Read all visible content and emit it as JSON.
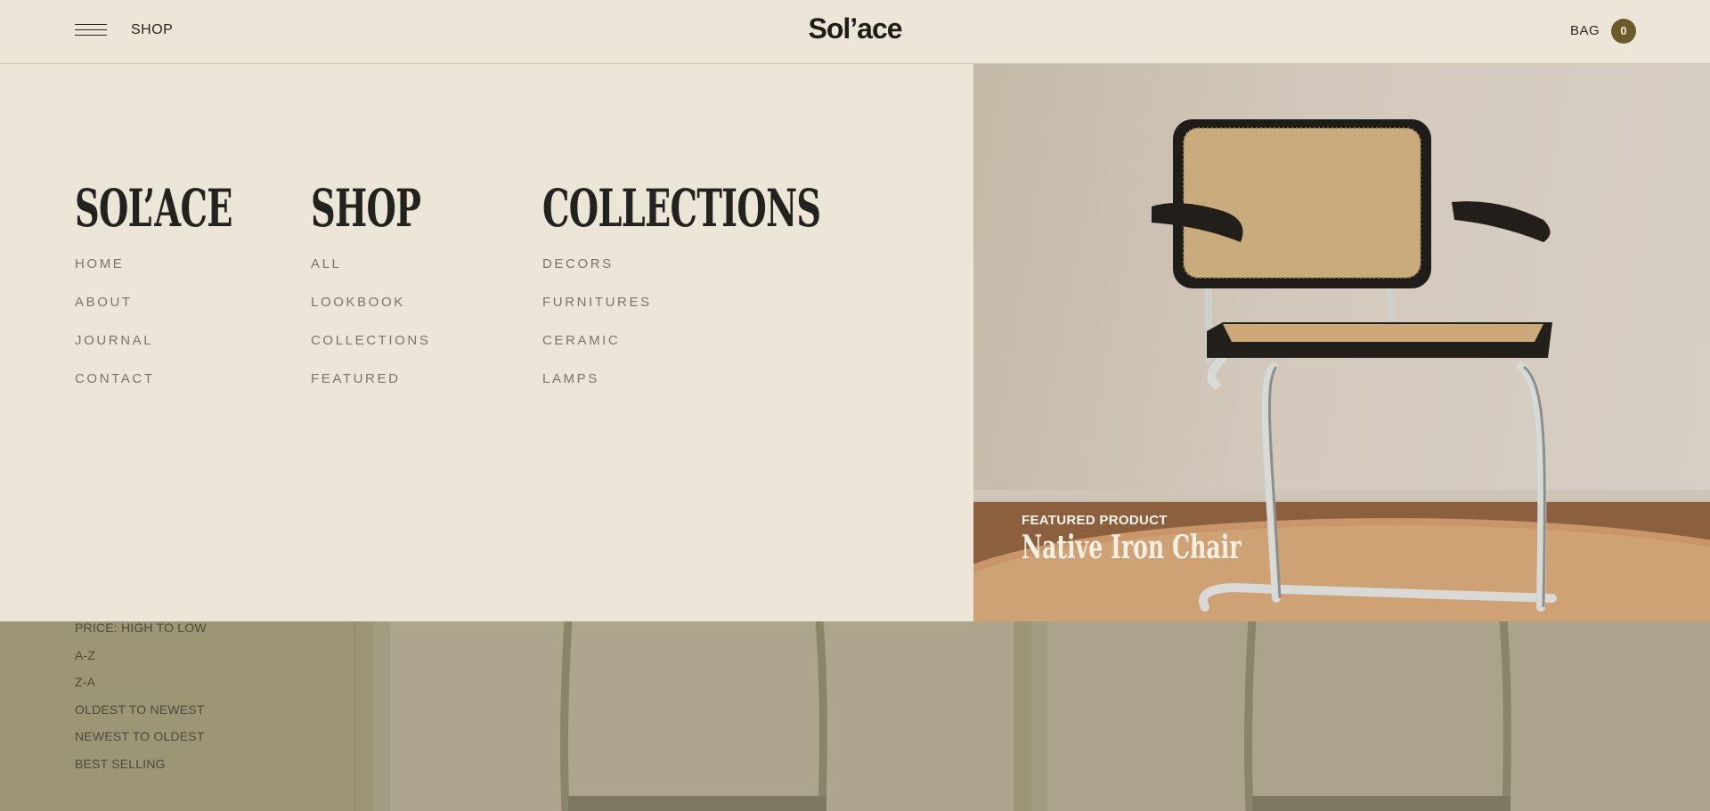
{
  "header": {
    "shop_label": "SHOP",
    "logo": "Sol’ace",
    "bag_label": "BAG",
    "bag_count": "0"
  },
  "menu": {
    "columns": [
      {
        "title": "SOL’ACE",
        "items": [
          "HOME",
          "ABOUT",
          "JOURNAL",
          "CONTACT"
        ]
      },
      {
        "title": "SHOP",
        "items": [
          "ALL",
          "LOOKBOOK",
          "COLLECTIONS",
          "FEATURED"
        ]
      },
      {
        "title": "COLLECTIONS",
        "items": [
          "DECORS",
          "FURNITURES",
          "CERAMIC",
          "LAMPS"
        ]
      }
    ]
  },
  "featured": {
    "label": "FEATURED PRODUCT",
    "name": "Native Iron Chair"
  },
  "sort_options": [
    "PRICE: HIGH TO LOW",
    "A-Z",
    "Z-A",
    "OLDEST TO NEWEST",
    "NEWEST TO OLDEST",
    "BEST SELLING"
  ],
  "colors": {
    "background": "#ece6d9",
    "overlay_dim": "#9c9676",
    "accent": "#6b5a2a"
  }
}
